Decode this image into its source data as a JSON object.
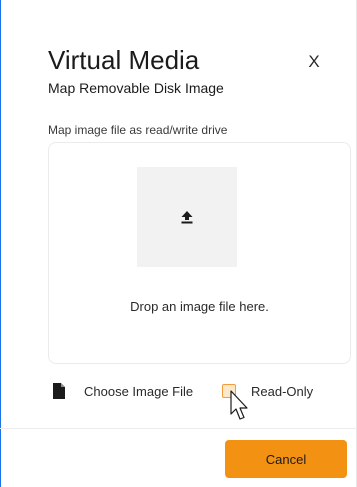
{
  "dialog": {
    "title": "Virtual Media",
    "subtitle": "Map Removable Disk Image",
    "close_label": "X"
  },
  "drop": {
    "label": "Map image file as read/write drive",
    "hint": "Drop an image file here."
  },
  "options": {
    "choose_file_label": "Choose Image File",
    "read_only_label": "Read-Only",
    "read_only_checked": false
  },
  "footer": {
    "cancel_label": "Cancel"
  },
  "icons": {
    "upload": "upload-icon",
    "file": "file-icon",
    "cursor": "mouse-pointer-icon"
  },
  "colors": {
    "accent": "#f39212",
    "checkbox_fill": "#fde9c9",
    "page_edge": "#1a73e8"
  }
}
